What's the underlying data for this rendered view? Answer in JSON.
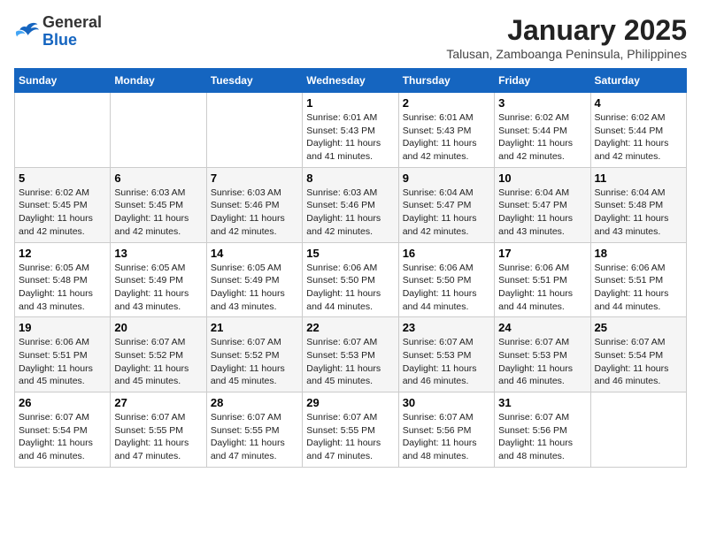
{
  "header": {
    "logo_general": "General",
    "logo_blue": "Blue",
    "month": "January 2025",
    "location": "Talusan, Zamboanga Peninsula, Philippines"
  },
  "days_of_week": [
    "Sunday",
    "Monday",
    "Tuesday",
    "Wednesday",
    "Thursday",
    "Friday",
    "Saturday"
  ],
  "weeks": [
    [
      {
        "day": "",
        "info": ""
      },
      {
        "day": "",
        "info": ""
      },
      {
        "day": "",
        "info": ""
      },
      {
        "day": "1",
        "info": "Sunrise: 6:01 AM\nSunset: 5:43 PM\nDaylight: 11 hours and 41 minutes."
      },
      {
        "day": "2",
        "info": "Sunrise: 6:01 AM\nSunset: 5:43 PM\nDaylight: 11 hours and 42 minutes."
      },
      {
        "day": "3",
        "info": "Sunrise: 6:02 AM\nSunset: 5:44 PM\nDaylight: 11 hours and 42 minutes."
      },
      {
        "day": "4",
        "info": "Sunrise: 6:02 AM\nSunset: 5:44 PM\nDaylight: 11 hours and 42 minutes."
      }
    ],
    [
      {
        "day": "5",
        "info": "Sunrise: 6:02 AM\nSunset: 5:45 PM\nDaylight: 11 hours and 42 minutes."
      },
      {
        "day": "6",
        "info": "Sunrise: 6:03 AM\nSunset: 5:45 PM\nDaylight: 11 hours and 42 minutes."
      },
      {
        "day": "7",
        "info": "Sunrise: 6:03 AM\nSunset: 5:46 PM\nDaylight: 11 hours and 42 minutes."
      },
      {
        "day": "8",
        "info": "Sunrise: 6:03 AM\nSunset: 5:46 PM\nDaylight: 11 hours and 42 minutes."
      },
      {
        "day": "9",
        "info": "Sunrise: 6:04 AM\nSunset: 5:47 PM\nDaylight: 11 hours and 42 minutes."
      },
      {
        "day": "10",
        "info": "Sunrise: 6:04 AM\nSunset: 5:47 PM\nDaylight: 11 hours and 43 minutes."
      },
      {
        "day": "11",
        "info": "Sunrise: 6:04 AM\nSunset: 5:48 PM\nDaylight: 11 hours and 43 minutes."
      }
    ],
    [
      {
        "day": "12",
        "info": "Sunrise: 6:05 AM\nSunset: 5:48 PM\nDaylight: 11 hours and 43 minutes."
      },
      {
        "day": "13",
        "info": "Sunrise: 6:05 AM\nSunset: 5:49 PM\nDaylight: 11 hours and 43 minutes."
      },
      {
        "day": "14",
        "info": "Sunrise: 6:05 AM\nSunset: 5:49 PM\nDaylight: 11 hours and 43 minutes."
      },
      {
        "day": "15",
        "info": "Sunrise: 6:06 AM\nSunset: 5:50 PM\nDaylight: 11 hours and 44 minutes."
      },
      {
        "day": "16",
        "info": "Sunrise: 6:06 AM\nSunset: 5:50 PM\nDaylight: 11 hours and 44 minutes."
      },
      {
        "day": "17",
        "info": "Sunrise: 6:06 AM\nSunset: 5:51 PM\nDaylight: 11 hours and 44 minutes."
      },
      {
        "day": "18",
        "info": "Sunrise: 6:06 AM\nSunset: 5:51 PM\nDaylight: 11 hours and 44 minutes."
      }
    ],
    [
      {
        "day": "19",
        "info": "Sunrise: 6:06 AM\nSunset: 5:51 PM\nDaylight: 11 hours and 45 minutes."
      },
      {
        "day": "20",
        "info": "Sunrise: 6:07 AM\nSunset: 5:52 PM\nDaylight: 11 hours and 45 minutes."
      },
      {
        "day": "21",
        "info": "Sunrise: 6:07 AM\nSunset: 5:52 PM\nDaylight: 11 hours and 45 minutes."
      },
      {
        "day": "22",
        "info": "Sunrise: 6:07 AM\nSunset: 5:53 PM\nDaylight: 11 hours and 45 minutes."
      },
      {
        "day": "23",
        "info": "Sunrise: 6:07 AM\nSunset: 5:53 PM\nDaylight: 11 hours and 46 minutes."
      },
      {
        "day": "24",
        "info": "Sunrise: 6:07 AM\nSunset: 5:53 PM\nDaylight: 11 hours and 46 minutes."
      },
      {
        "day": "25",
        "info": "Sunrise: 6:07 AM\nSunset: 5:54 PM\nDaylight: 11 hours and 46 minutes."
      }
    ],
    [
      {
        "day": "26",
        "info": "Sunrise: 6:07 AM\nSunset: 5:54 PM\nDaylight: 11 hours and 46 minutes."
      },
      {
        "day": "27",
        "info": "Sunrise: 6:07 AM\nSunset: 5:55 PM\nDaylight: 11 hours and 47 minutes."
      },
      {
        "day": "28",
        "info": "Sunrise: 6:07 AM\nSunset: 5:55 PM\nDaylight: 11 hours and 47 minutes."
      },
      {
        "day": "29",
        "info": "Sunrise: 6:07 AM\nSunset: 5:55 PM\nDaylight: 11 hours and 47 minutes."
      },
      {
        "day": "30",
        "info": "Sunrise: 6:07 AM\nSunset: 5:56 PM\nDaylight: 11 hours and 48 minutes."
      },
      {
        "day": "31",
        "info": "Sunrise: 6:07 AM\nSunset: 5:56 PM\nDaylight: 11 hours and 48 minutes."
      },
      {
        "day": "",
        "info": ""
      }
    ]
  ]
}
